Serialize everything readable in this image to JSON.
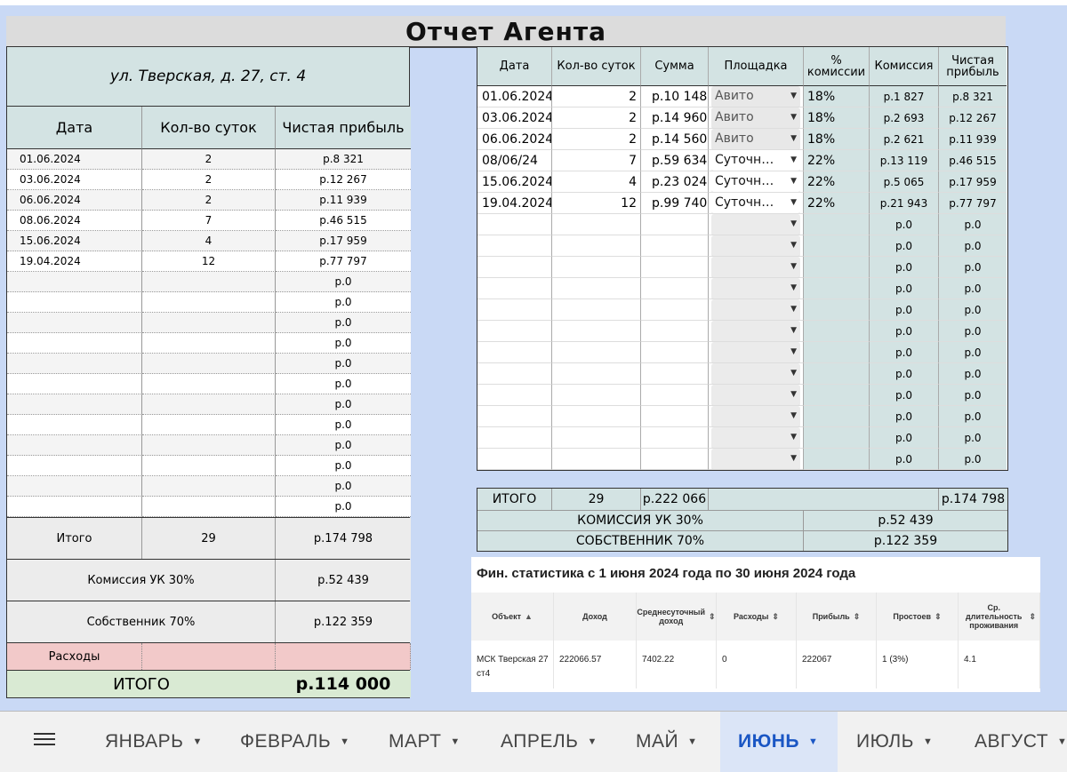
{
  "title": "Отчет Агента",
  "address": "ул. Тверская, д. 27, ст. 4",
  "left_table": {
    "headers": [
      "Дата",
      "Кол-во суток",
      "Чистая прибыль"
    ],
    "rows": [
      [
        "01.06.2024",
        "2",
        "р.8 321"
      ],
      [
        "03.06.2024",
        "2",
        "р.12 267"
      ],
      [
        "06.06.2024",
        "2",
        "р.11 939"
      ],
      [
        "08.06.2024",
        "7",
        "р.46 515"
      ],
      [
        "15.06.2024",
        "4",
        "р.17 959"
      ],
      [
        "19.04.2024",
        "12",
        "р.77 797"
      ],
      [
        "",
        "",
        "р.0"
      ],
      [
        "",
        "",
        "р.0"
      ],
      [
        "",
        "",
        "р.0"
      ],
      [
        "",
        "",
        "р.0"
      ],
      [
        "",
        "",
        "р.0"
      ],
      [
        "",
        "",
        "р.0"
      ],
      [
        "",
        "",
        "р.0"
      ],
      [
        "",
        "",
        "р.0"
      ],
      [
        "",
        "",
        "р.0"
      ],
      [
        "",
        "",
        "р.0"
      ],
      [
        "",
        "",
        "р.0"
      ],
      [
        "",
        "",
        "р.0"
      ]
    ],
    "total_label": "Итого",
    "total_days": "29",
    "total_profit": "р.174 798",
    "commission_label": "Комиссия УК 30%",
    "commission_value": "р.52 439",
    "owner_label": "Собственник 70%",
    "owner_value": "р.122 359",
    "expenses_label": "Расходы",
    "grand_total_label": "ИТОГО",
    "grand_total_value": "р.114 000"
  },
  "right_table": {
    "headers": [
      "Дата",
      "Кол-во суток",
      "Сумма",
      "Площадка",
      "% комиссии",
      "Комиссия",
      "Чистая прибыль"
    ],
    "rows": [
      {
        "date": "01.06.2024",
        "days": "2",
        "sum": "р.10 148",
        "platform": "Авито",
        "pct": "18%",
        "commission": "р.1 827",
        "net": "р.8 321"
      },
      {
        "date": "03.06.2024",
        "days": "2",
        "sum": "р.14 960",
        "platform": "Авито",
        "pct": "18%",
        "commission": "р.2 693",
        "net": "р.12 267"
      },
      {
        "date": "06.06.2024",
        "days": "2",
        "sum": "р.14 560",
        "platform": "Авито",
        "pct": "18%",
        "commission": "р.2 621",
        "net": "р.11 939"
      },
      {
        "date": "08/06/24",
        "days": "7",
        "sum": "р.59 634",
        "platform": "Суточн…",
        "pct": "22%",
        "commission": "р.13 119",
        "net": "р.46 515"
      },
      {
        "date": "15.06.2024",
        "days": "4",
        "sum": "р.23 024",
        "platform": "Суточн…",
        "pct": "22%",
        "commission": "р.5 065",
        "net": "р.17 959"
      },
      {
        "date": "19.04.2024",
        "days": "12",
        "sum": "р.99 740",
        "platform": "Суточн…",
        "pct": "22%",
        "commission": "р.21 943",
        "net": "р.77 797"
      },
      {
        "date": "",
        "days": "",
        "sum": "",
        "platform": "",
        "pct": "",
        "commission": "р.0",
        "net": "р.0"
      },
      {
        "date": "",
        "days": "",
        "sum": "",
        "platform": "",
        "pct": "",
        "commission": "р.0",
        "net": "р.0"
      },
      {
        "date": "",
        "days": "",
        "sum": "",
        "platform": "",
        "pct": "",
        "commission": "р.0",
        "net": "р.0"
      },
      {
        "date": "",
        "days": "",
        "sum": "",
        "platform": "",
        "pct": "",
        "commission": "р.0",
        "net": "р.0"
      },
      {
        "date": "",
        "days": "",
        "sum": "",
        "platform": "",
        "pct": "",
        "commission": "р.0",
        "net": "р.0"
      },
      {
        "date": "",
        "days": "",
        "sum": "",
        "platform": "",
        "pct": "",
        "commission": "р.0",
        "net": "р.0"
      },
      {
        "date": "",
        "days": "",
        "sum": "",
        "platform": "",
        "pct": "",
        "commission": "р.0",
        "net": "р.0"
      },
      {
        "date": "",
        "days": "",
        "sum": "",
        "platform": "",
        "pct": "",
        "commission": "р.0",
        "net": "р.0"
      },
      {
        "date": "",
        "days": "",
        "sum": "",
        "platform": "",
        "pct": "",
        "commission": "р.0",
        "net": "р.0"
      },
      {
        "date": "",
        "days": "",
        "sum": "",
        "platform": "",
        "pct": "",
        "commission": "р.0",
        "net": "р.0"
      },
      {
        "date": "",
        "days": "",
        "sum": "",
        "platform": "",
        "pct": "",
        "commission": "р.0",
        "net": "р.0"
      },
      {
        "date": "",
        "days": "",
        "sum": "",
        "platform": "",
        "pct": "",
        "commission": "р.0",
        "net": "р.0"
      }
    ]
  },
  "right_summary": {
    "total_label": "ИТОГО",
    "total_days": "29",
    "total_sum": "р.222 066",
    "total_net": "р.174 798",
    "commission_label": "КОМИССИЯ УК 30%",
    "commission_value": "р.52 439",
    "owner_label": "СОБСТВЕННИК 70%",
    "owner_value": "р.122 359"
  },
  "fin_stats": {
    "title": "Фин. статистика с 1 июня 2024 года по 30 июня 2024 года",
    "headers": [
      "Объект",
      "Доход",
      "Среднесуточный доход",
      "Расходы",
      "Прибыль",
      "Простоев",
      "Ср. длительность проживания"
    ],
    "row": [
      "МСК Тверская 27 ст4",
      "222066.57",
      "7402.22",
      "0",
      "222067",
      "1 (3%)",
      "4.1"
    ]
  },
  "tabs": {
    "items": [
      "ЯНВАРЬ",
      "ФЕВРАЛЬ",
      "МАРТ",
      "АПРЕЛЬ",
      "МАЙ",
      "ИЮНЬ",
      "ИЮЛЬ",
      "АВГУСТ"
    ],
    "active": "ИЮНЬ",
    "dropdown_icon": "triangle-down-icon",
    "menu_icon": "hamburger-menu-icon"
  },
  "colors": {
    "header_teal": "#d3e3e3",
    "expenses_pink": "#f2c9c9",
    "total_green": "#d9ead3",
    "active_tab_blue": "#1a56c4",
    "page_bg": "#c9d9f5"
  }
}
